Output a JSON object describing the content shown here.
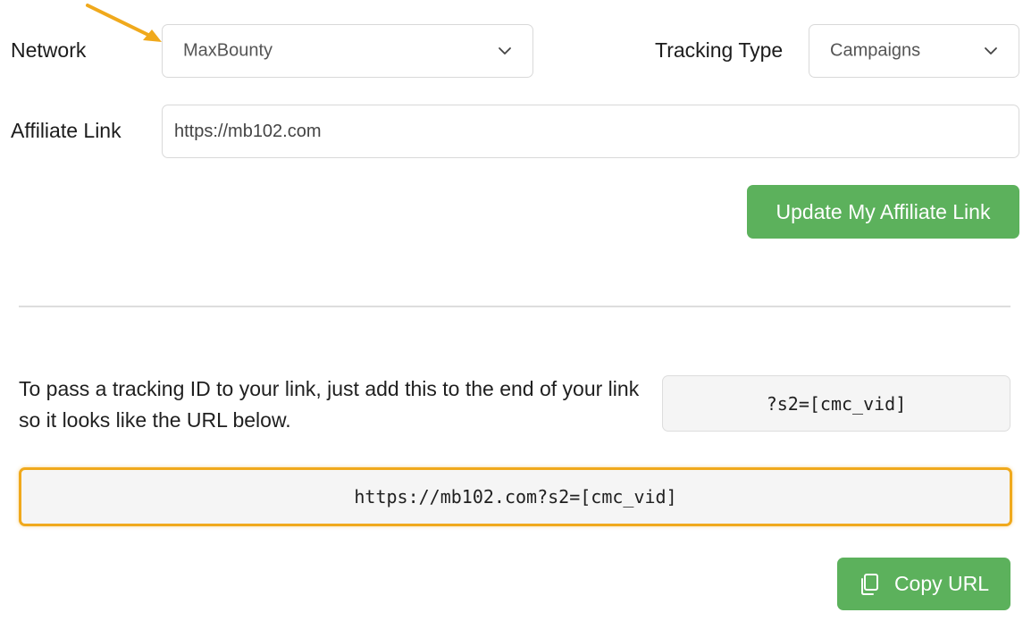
{
  "form": {
    "network_label": "Network",
    "network_value": "MaxBounty",
    "tracking_type_label": "Tracking Type",
    "tracking_type_value": "Campaigns",
    "affiliate_link_label": "Affiliate Link",
    "affiliate_link_value": "https://mb102.com",
    "update_button_label": "Update My Affiliate Link"
  },
  "tracking": {
    "instructions": "To pass a tracking ID to your link, just add this to the end of your link so it looks like the URL below.",
    "param_code": "?s2=[cmc_vid]",
    "final_url": "https://mb102.com?s2=[cmc_vid]",
    "copy_button_label": "Copy URL"
  },
  "icons": {
    "chevron": "chevron-down-icon",
    "copy": "copy-icon",
    "annotation_arrow": "arrow-annotation-icon"
  },
  "colors": {
    "accent_green": "#5cb15c",
    "highlight_orange": "#f0a91c",
    "arrow_orange": "#f0a91c"
  }
}
